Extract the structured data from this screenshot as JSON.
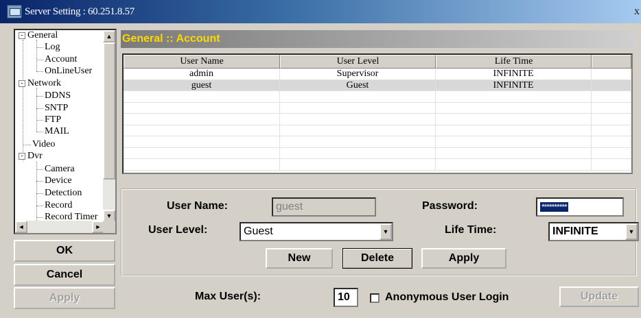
{
  "window": {
    "title": "Server Setting : 60.251.8.57",
    "close": "x"
  },
  "tree": {
    "items": [
      {
        "label": "General",
        "expander": "-"
      },
      {
        "label": "Log"
      },
      {
        "label": "Account"
      },
      {
        "label": "OnLineUser"
      },
      {
        "label": "Network",
        "expander": "-"
      },
      {
        "label": "DDNS"
      },
      {
        "label": "SNTP"
      },
      {
        "label": "FTP"
      },
      {
        "label": "MAIL"
      },
      {
        "label": "Video"
      },
      {
        "label": "Dvr",
        "expander": "-"
      },
      {
        "label": "Camera"
      },
      {
        "label": "Device"
      },
      {
        "label": "Detection"
      },
      {
        "label": "Record"
      },
      {
        "label": "Record Timer"
      }
    ],
    "scroll_up": "▲",
    "scroll_down": "▼",
    "scroll_left": "◄",
    "scroll_right": "►"
  },
  "left_buttons": {
    "ok": "OK",
    "cancel": "Cancel",
    "apply": "Apply"
  },
  "section": {
    "header": "General :: Account"
  },
  "users_table": {
    "headers": [
      "User Name",
      "User Level",
      "Life Time",
      ""
    ],
    "rows": [
      [
        "admin",
        "Supervisor",
        "INFINITE",
        ""
      ],
      [
        "guest",
        "Guest",
        "INFINITE",
        ""
      ],
      [
        "",
        "",
        "",
        ""
      ],
      [
        "",
        "",
        "",
        ""
      ],
      [
        "",
        "",
        "",
        ""
      ],
      [
        "",
        "",
        "",
        ""
      ],
      [
        "",
        "",
        "",
        ""
      ],
      [
        "",
        "",
        "",
        ""
      ],
      [
        "",
        "",
        "",
        ""
      ]
    ]
  },
  "form": {
    "user_name_label": "User Name:",
    "user_name_value": "guest",
    "password_label": "Password:",
    "password_value": "**********",
    "user_level_label": "User Level:",
    "user_level_value": "Guest",
    "life_time_label": "Life Time:",
    "life_time_value": "INFINITE",
    "new": "New",
    "delete": "Delete",
    "apply": "Apply",
    "dropdown_arrow": "▼"
  },
  "footer": {
    "max_users_label": "Max User(s):",
    "max_users_value": "10",
    "anonymous_label": "Anonymous User Login",
    "update": "Update"
  }
}
